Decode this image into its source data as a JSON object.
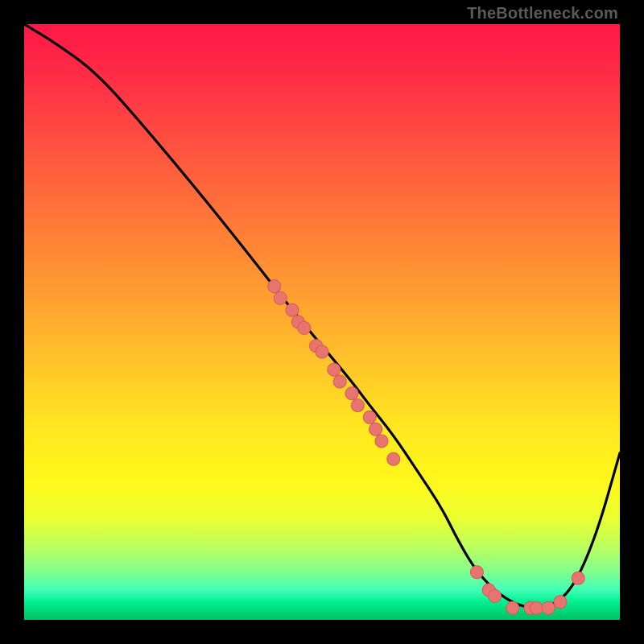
{
  "watermark": "TheBottleneck.com",
  "chart_data": {
    "type": "line",
    "title": "",
    "xlabel": "",
    "ylabel": "",
    "xlim": [
      0,
      100
    ],
    "ylim": [
      0,
      100
    ],
    "series": [
      {
        "name": "curve",
        "x": [
          0,
          5,
          12,
          20,
          30,
          38,
          45,
          50,
          55,
          58,
          62,
          66,
          70,
          73,
          76,
          80,
          84,
          88,
          92,
          96,
          100
        ],
        "y": [
          100,
          97,
          92,
          83,
          71,
          61,
          52,
          46,
          40,
          36,
          31,
          25,
          19,
          13,
          8,
          4,
          2,
          2,
          5,
          14,
          28
        ]
      }
    ],
    "markers": {
      "name": "highlighted-points",
      "color": "#e87470",
      "points": [
        {
          "x": 42,
          "y": 56
        },
        {
          "x": 43,
          "y": 54
        },
        {
          "x": 45,
          "y": 52
        },
        {
          "x": 46,
          "y": 50
        },
        {
          "x": 47,
          "y": 49
        },
        {
          "x": 49,
          "y": 46
        },
        {
          "x": 50,
          "y": 45
        },
        {
          "x": 52,
          "y": 42
        },
        {
          "x": 53,
          "y": 40
        },
        {
          "x": 55,
          "y": 38
        },
        {
          "x": 56,
          "y": 36
        },
        {
          "x": 58,
          "y": 34
        },
        {
          "x": 59,
          "y": 32
        },
        {
          "x": 60,
          "y": 30
        },
        {
          "x": 62,
          "y": 27
        },
        {
          "x": 76,
          "y": 8
        },
        {
          "x": 78,
          "y": 5
        },
        {
          "x": 79,
          "y": 4
        },
        {
          "x": 82,
          "y": 2
        },
        {
          "x": 85,
          "y": 2
        },
        {
          "x": 86,
          "y": 2
        },
        {
          "x": 88,
          "y": 2
        },
        {
          "x": 90,
          "y": 3
        },
        {
          "x": 93,
          "y": 7
        }
      ]
    },
    "background_gradient": {
      "top": "#ff1846",
      "bottom": "#00c060",
      "stops": [
        "#ff1846",
        "#ff7838",
        "#ffe820",
        "#80ff90",
        "#00c060"
      ]
    }
  }
}
